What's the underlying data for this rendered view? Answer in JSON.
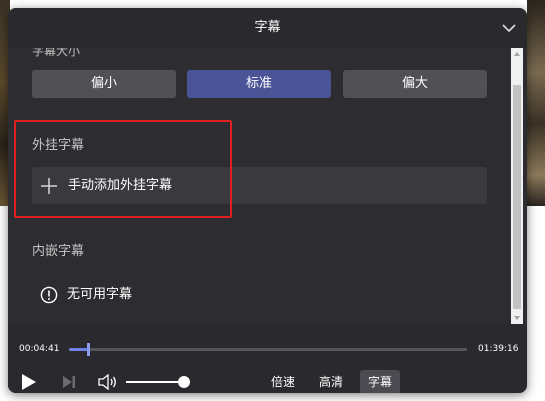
{
  "panel": {
    "title": "字幕"
  },
  "font_size_section": {
    "heading": "字幕大小",
    "options": [
      {
        "label": "偏小",
        "active": false
      },
      {
        "label": "标准",
        "active": true
      },
      {
        "label": "偏大",
        "active": false
      }
    ]
  },
  "external_subtitle": {
    "heading": "外挂字幕",
    "add_label": "手动添加外挂字幕"
  },
  "embedded_subtitle": {
    "heading": "内嵌字幕",
    "empty_label": "无可用字幕"
  },
  "player": {
    "current_time": "00:04:41",
    "total_time": "01:39:16",
    "progress": 0.05,
    "volume": 1.0,
    "speed_label": "倍速",
    "quality_label": "高清",
    "subtitle_label": "字幕",
    "subtitle_active": true
  },
  "colors": {
    "panel_bg": "#2a2a2e",
    "accent": "#4a5496",
    "progress": "#6f83e6",
    "highlight": "#e02020"
  },
  "icons": {
    "collapse": "chevron-down-icon",
    "add": "plus-icon",
    "info": "info-circle-icon",
    "play": "play-icon",
    "next": "skip-next-icon",
    "volume": "volume-icon"
  }
}
